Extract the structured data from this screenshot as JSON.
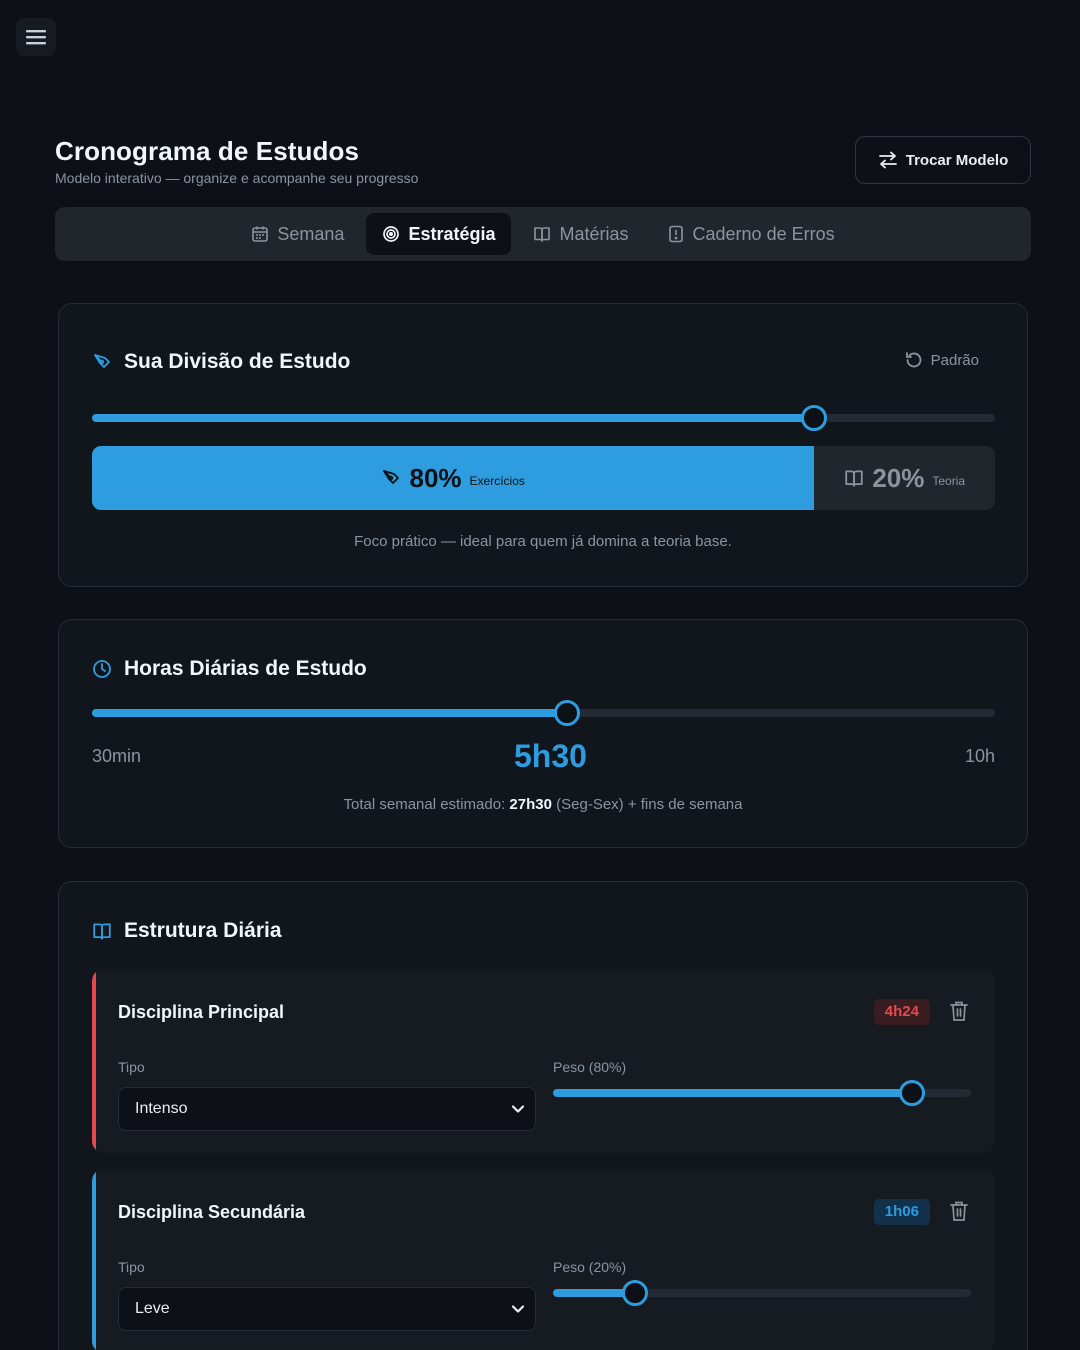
{
  "header": {
    "title": "Cronograma de Estudos",
    "subtitle": "Modelo interativo — organize e acompanhe seu progresso",
    "swap_button": "Trocar Modelo"
  },
  "tabs": [
    {
      "label": "Semana",
      "icon": "calendar-icon",
      "active": false
    },
    {
      "label": "Estratégia",
      "icon": "target-icon",
      "active": true
    },
    {
      "label": "Matérias",
      "icon": "book-icon",
      "active": false
    },
    {
      "label": "Caderno de Erros",
      "icon": "notebook-icon",
      "active": false
    }
  ],
  "division": {
    "title": "Sua Divisão de Estudo",
    "reset_label": "Padrão",
    "slider_value": 0.8,
    "exercises_pct": "80%",
    "exercises_label": "Exercícios",
    "theory_pct": "20%",
    "theory_label": "Teoria",
    "note": "Foco prático — ideal para quem já domina a teoria base."
  },
  "hours": {
    "title": "Horas Diárias de Estudo",
    "min_label": "30min",
    "max_label": "10h",
    "value_label": "5h30",
    "slider_value": 0.526,
    "total_prefix": "Total semanal estimado:",
    "total_value": "27h30",
    "total_suffix": "(Seg-Sex) + fins de semana"
  },
  "structure": {
    "title": "Estrutura Diária",
    "type_label": "Tipo",
    "blocks": [
      {
        "name": "Disciplina Principal",
        "badge": "4h24",
        "color": "#e5484d",
        "badge_bg": "#3a1d20",
        "type_value": "Intenso",
        "weight_label": "Peso (80%)",
        "weight_value": 0.86
      },
      {
        "name": "Disciplina Secundária",
        "badge": "1h06",
        "color": "#2d9de0",
        "badge_bg": "#13314a",
        "type_value": "Leve",
        "weight_label": "Peso (20%)",
        "weight_value": 0.196
      }
    ]
  },
  "colors": {
    "accent": "#2d9de0",
    "danger": "#e5484d",
    "background": "#0d1117"
  }
}
